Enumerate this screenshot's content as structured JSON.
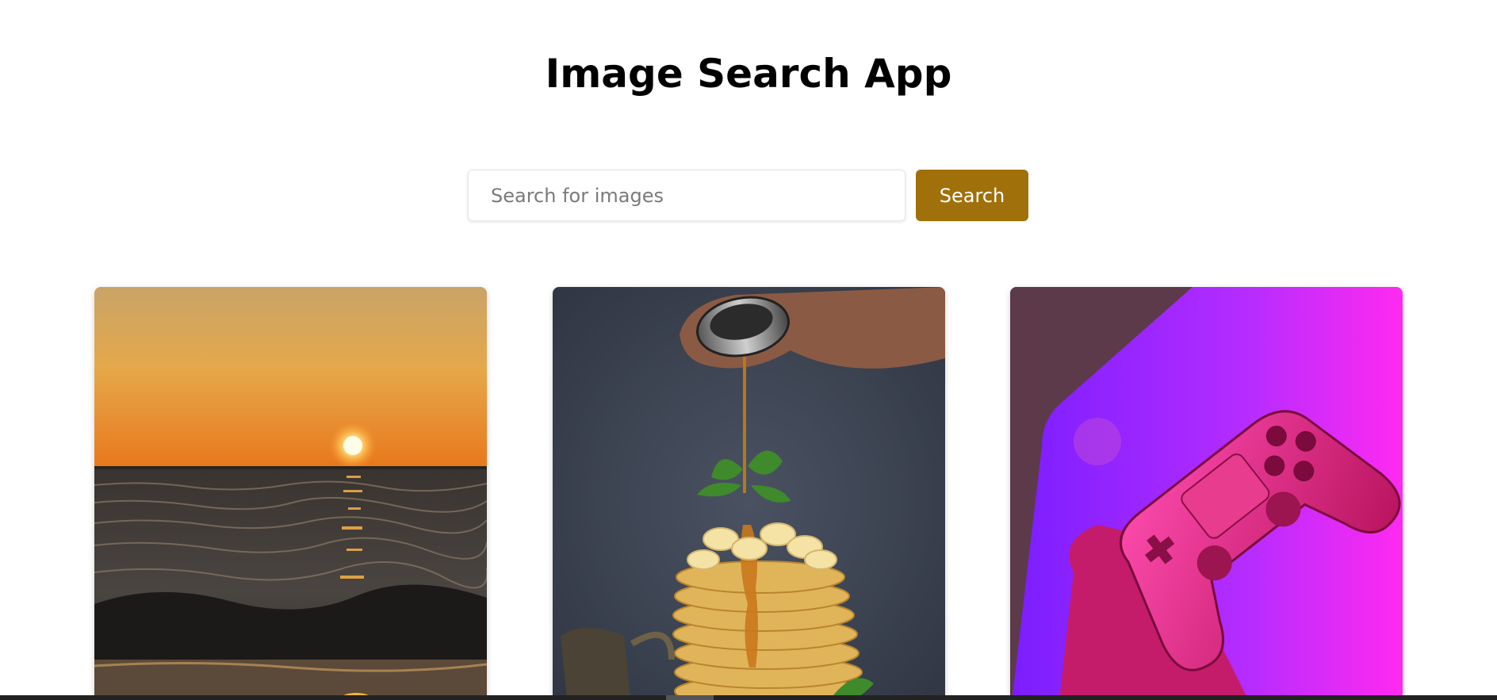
{
  "header": {
    "title": "Image Search App"
  },
  "search": {
    "placeholder": "Search for images",
    "value": "",
    "button_label": "Search"
  },
  "results": [
    {
      "name": "sunset-ocean-image"
    },
    {
      "name": "pancakes-syrup-image"
    },
    {
      "name": "game-controller-image"
    }
  ],
  "colors": {
    "accent": "#a0700b",
    "background": "#ffffff"
  }
}
